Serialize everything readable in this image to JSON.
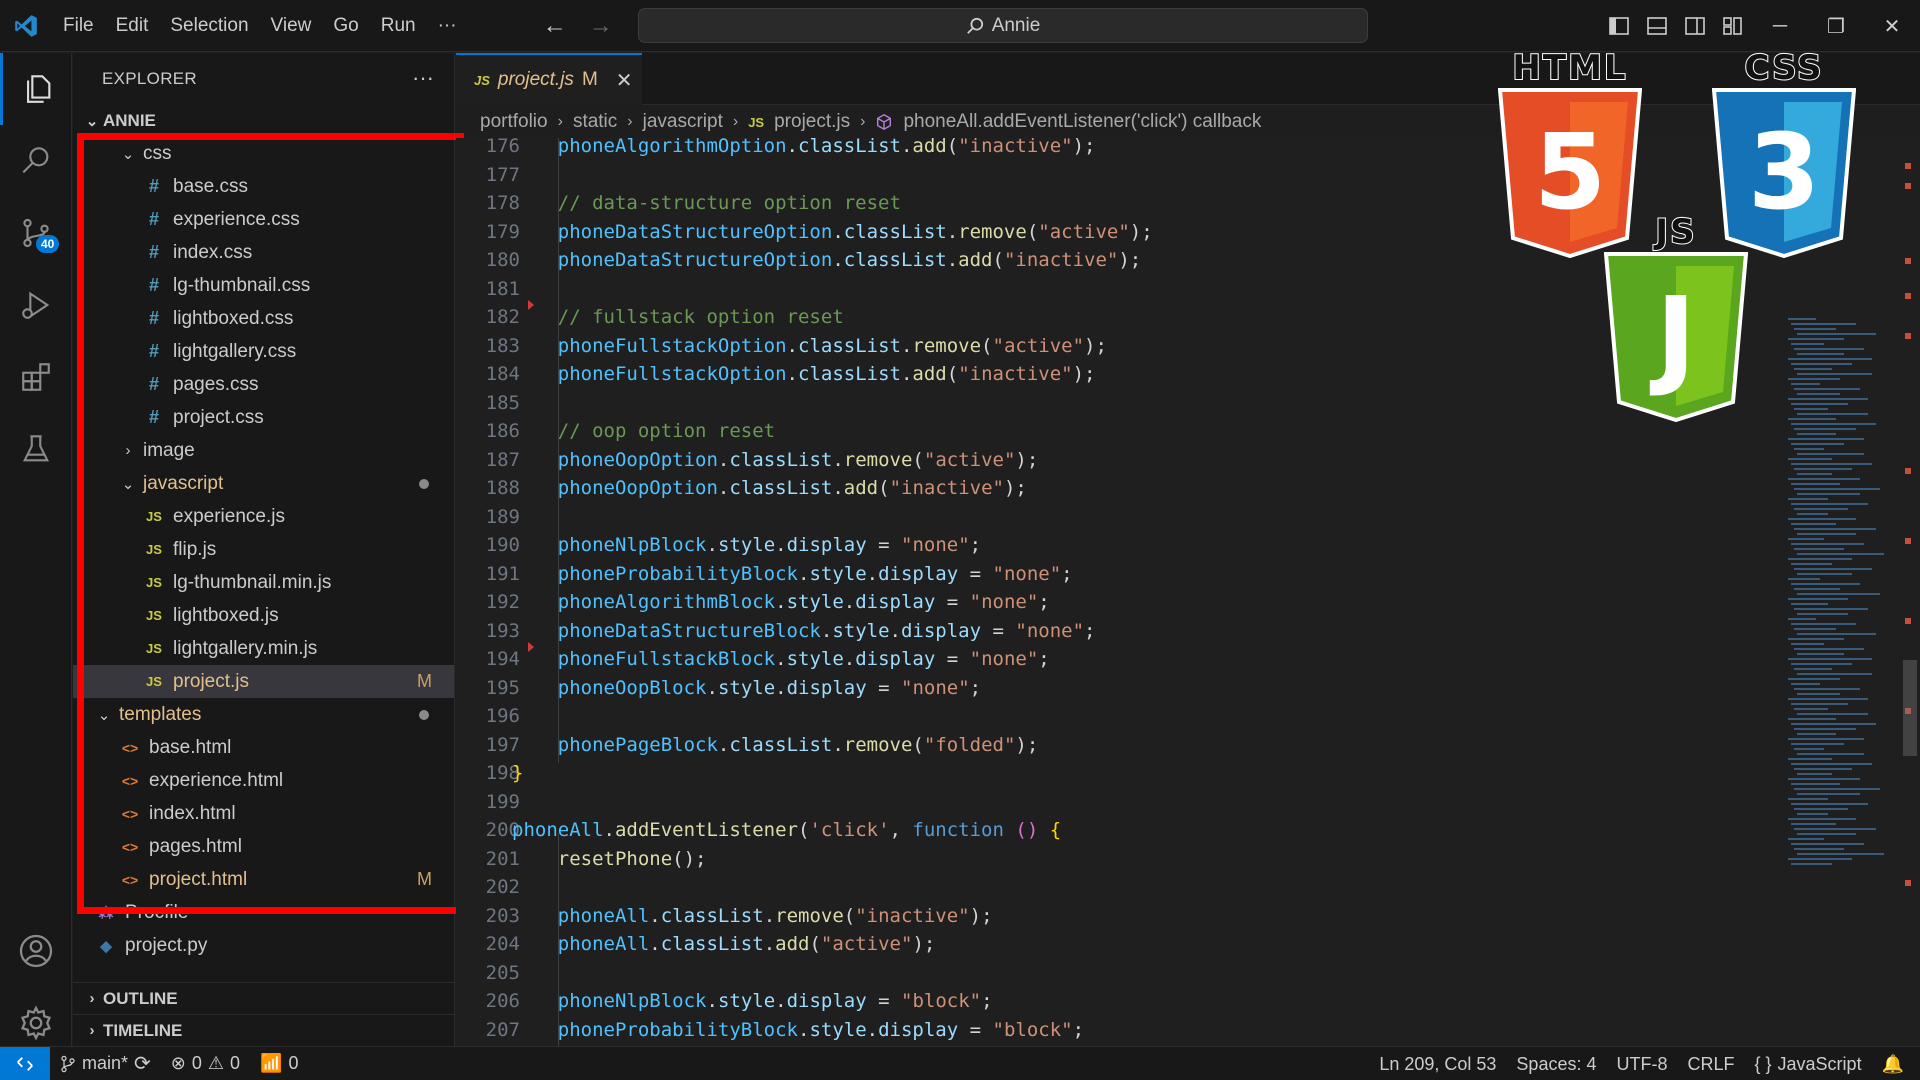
{
  "menu": [
    "File",
    "Edit",
    "Selection",
    "View",
    "Go",
    "Run",
    "···"
  ],
  "search": {
    "text": "Annie"
  },
  "activity": {
    "badge": "40"
  },
  "explorer": {
    "title": "EXPLORER",
    "more": "···",
    "root": "ANNIE",
    "tree": [
      {
        "label": "css",
        "type": "folder",
        "open": true,
        "indent": 1
      },
      {
        "label": "base.css",
        "type": "css",
        "indent": 2
      },
      {
        "label": "experience.css",
        "type": "css",
        "indent": 2
      },
      {
        "label": "index.css",
        "type": "css",
        "indent": 2
      },
      {
        "label": "lg-thumbnail.css",
        "type": "css",
        "indent": 2
      },
      {
        "label": "lightboxed.css",
        "type": "css",
        "indent": 2
      },
      {
        "label": "lightgallery.css",
        "type": "css",
        "indent": 2
      },
      {
        "label": "pages.css",
        "type": "css",
        "indent": 2
      },
      {
        "label": "project.css",
        "type": "css",
        "indent": 2
      },
      {
        "label": "image",
        "type": "folder",
        "open": false,
        "indent": 1
      },
      {
        "label": "javascript",
        "type": "folder",
        "open": true,
        "indent": 1,
        "modified_dot": true
      },
      {
        "label": "experience.js",
        "type": "js",
        "indent": 2
      },
      {
        "label": "flip.js",
        "type": "js",
        "indent": 2
      },
      {
        "label": "lg-thumbnail.min.js",
        "type": "js",
        "indent": 2
      },
      {
        "label": "lightboxed.js",
        "type": "js",
        "indent": 2
      },
      {
        "label": "lightgallery.min.js",
        "type": "js",
        "indent": 2
      },
      {
        "label": "project.js",
        "type": "js",
        "indent": 2,
        "status": "M",
        "selected": true
      },
      {
        "label": "templates",
        "type": "folder",
        "open": true,
        "indent": 0,
        "modified_dot": true
      },
      {
        "label": "base.html",
        "type": "html",
        "indent": 1
      },
      {
        "label": "experience.html",
        "type": "html",
        "indent": 1
      },
      {
        "label": "index.html",
        "type": "html",
        "indent": 1
      },
      {
        "label": "pages.html",
        "type": "html",
        "indent": 1
      },
      {
        "label": "project.html",
        "type": "html",
        "indent": 1,
        "status": "M"
      },
      {
        "label": "Procfile",
        "type": "proc",
        "indent": 0
      },
      {
        "label": "project.py",
        "type": "py",
        "indent": 0
      }
    ],
    "outline": "OUTLINE",
    "timeline": "TIMELINE"
  },
  "tab": {
    "icon": "JS",
    "name": "project.js",
    "status": "M"
  },
  "breadcrumb": [
    "portfolio",
    "static",
    "javascript",
    "project.js",
    "phoneAll.addEventListener('click') callback"
  ],
  "code": [
    {
      "n": "176",
      "t": [
        [
          "    ",
          ""
        ],
        [
          "phoneAlgorithmOption",
          "var"
        ],
        [
          ".",
          ""
        ],
        [
          "classList",
          "prop"
        ],
        [
          ".",
          ""
        ],
        [
          "add",
          "fn"
        ],
        [
          "(",
          ""
        ],
        [
          "\"inactive\"",
          "str"
        ],
        [
          ");",
          ""
        ]
      ]
    },
    {
      "n": "177",
      "t": []
    },
    {
      "n": "178",
      "t": [
        [
          "    ",
          ""
        ],
        [
          "// data-structure option reset",
          "com"
        ]
      ]
    },
    {
      "n": "179",
      "t": [
        [
          "    ",
          ""
        ],
        [
          "phoneDataStructureOption",
          "var"
        ],
        [
          ".",
          ""
        ],
        [
          "classList",
          "prop"
        ],
        [
          ".",
          ""
        ],
        [
          "remove",
          "fn"
        ],
        [
          "(",
          ""
        ],
        [
          "\"active\"",
          "str"
        ],
        [
          ");",
          ""
        ]
      ]
    },
    {
      "n": "180",
      "t": [
        [
          "    ",
          ""
        ],
        [
          "phoneDataStructureOption",
          "var"
        ],
        [
          ".",
          ""
        ],
        [
          "classList",
          "prop"
        ],
        [
          ".",
          ""
        ],
        [
          "add",
          "fn"
        ],
        [
          "(",
          ""
        ],
        [
          "\"inactive\"",
          "str"
        ],
        [
          ");",
          ""
        ]
      ]
    },
    {
      "n": "181",
      "t": []
    },
    {
      "n": "182",
      "t": [
        [
          "    ",
          ""
        ],
        [
          "// fullstack option reset",
          "com"
        ]
      ]
    },
    {
      "n": "183",
      "t": [
        [
          "    ",
          ""
        ],
        [
          "phoneFullstackOption",
          "var"
        ],
        [
          ".",
          ""
        ],
        [
          "classList",
          "prop"
        ],
        [
          ".",
          ""
        ],
        [
          "remove",
          "fn"
        ],
        [
          "(",
          ""
        ],
        [
          "\"active\"",
          "str"
        ],
        [
          ");",
          ""
        ]
      ]
    },
    {
      "n": "184",
      "t": [
        [
          "    ",
          ""
        ],
        [
          "phoneFullstackOption",
          "var"
        ],
        [
          ".",
          ""
        ],
        [
          "classList",
          "prop"
        ],
        [
          ".",
          ""
        ],
        [
          "add",
          "fn"
        ],
        [
          "(",
          ""
        ],
        [
          "\"inactive\"",
          "str"
        ],
        [
          ");",
          ""
        ]
      ]
    },
    {
      "n": "185",
      "t": []
    },
    {
      "n": "186",
      "t": [
        [
          "    ",
          ""
        ],
        [
          "// oop option reset",
          "com"
        ]
      ]
    },
    {
      "n": "187",
      "t": [
        [
          "    ",
          ""
        ],
        [
          "phoneOopOption",
          "var"
        ],
        [
          ".",
          ""
        ],
        [
          "classList",
          "prop"
        ],
        [
          ".",
          ""
        ],
        [
          "remove",
          "fn"
        ],
        [
          "(",
          ""
        ],
        [
          "\"active\"",
          "str"
        ],
        [
          ");",
          ""
        ]
      ]
    },
    {
      "n": "188",
      "t": [
        [
          "    ",
          ""
        ],
        [
          "phoneOopOption",
          "var"
        ],
        [
          ".",
          ""
        ],
        [
          "classList",
          "prop"
        ],
        [
          ".",
          ""
        ],
        [
          "add",
          "fn"
        ],
        [
          "(",
          ""
        ],
        [
          "\"inactive\"",
          "str"
        ],
        [
          ");",
          ""
        ]
      ]
    },
    {
      "n": "189",
      "t": []
    },
    {
      "n": "190",
      "t": [
        [
          "    ",
          ""
        ],
        [
          "phoneNlpBlock",
          "var"
        ],
        [
          ".",
          ""
        ],
        [
          "style",
          "prop"
        ],
        [
          ".",
          ""
        ],
        [
          "display",
          "prop"
        ],
        [
          " = ",
          ""
        ],
        [
          "\"none\"",
          "str"
        ],
        [
          ";",
          ""
        ]
      ]
    },
    {
      "n": "191",
      "t": [
        [
          "    ",
          ""
        ],
        [
          "phoneProbabilityBlock",
          "var"
        ],
        [
          ".",
          ""
        ],
        [
          "style",
          "prop"
        ],
        [
          ".",
          ""
        ],
        [
          "display",
          "prop"
        ],
        [
          " = ",
          ""
        ],
        [
          "\"none\"",
          "str"
        ],
        [
          ";",
          ""
        ]
      ]
    },
    {
      "n": "192",
      "t": [
        [
          "    ",
          ""
        ],
        [
          "phoneAlgorithmBlock",
          "var"
        ],
        [
          ".",
          ""
        ],
        [
          "style",
          "prop"
        ],
        [
          ".",
          ""
        ],
        [
          "display",
          "prop"
        ],
        [
          " = ",
          ""
        ],
        [
          "\"none\"",
          "str"
        ],
        [
          ";",
          ""
        ]
      ]
    },
    {
      "n": "193",
      "t": [
        [
          "    ",
          ""
        ],
        [
          "phoneDataStructureBlock",
          "var"
        ],
        [
          ".",
          ""
        ],
        [
          "style",
          "prop"
        ],
        [
          ".",
          ""
        ],
        [
          "display",
          "prop"
        ],
        [
          " = ",
          ""
        ],
        [
          "\"none\"",
          "str"
        ],
        [
          ";",
          ""
        ]
      ]
    },
    {
      "n": "194",
      "t": [
        [
          "    ",
          ""
        ],
        [
          "phoneFullstackBlock",
          "var"
        ],
        [
          ".",
          ""
        ],
        [
          "style",
          "prop"
        ],
        [
          ".",
          ""
        ],
        [
          "display",
          "prop"
        ],
        [
          " = ",
          ""
        ],
        [
          "\"none\"",
          "str"
        ],
        [
          ";",
          ""
        ]
      ]
    },
    {
      "n": "195",
      "t": [
        [
          "    ",
          ""
        ],
        [
          "phoneOopBlock",
          "var"
        ],
        [
          ".",
          ""
        ],
        [
          "style",
          "prop"
        ],
        [
          ".",
          ""
        ],
        [
          "display",
          "prop"
        ],
        [
          " = ",
          ""
        ],
        [
          "\"none\"",
          "str"
        ],
        [
          ";",
          ""
        ]
      ]
    },
    {
      "n": "196",
      "t": []
    },
    {
      "n": "197",
      "t": [
        [
          "    ",
          ""
        ],
        [
          "phonePageBlock",
          "var"
        ],
        [
          ".",
          ""
        ],
        [
          "classList",
          "prop"
        ],
        [
          ".",
          ""
        ],
        [
          "remove",
          "fn"
        ],
        [
          "(",
          ""
        ],
        [
          "\"folded\"",
          "str"
        ],
        [
          ");",
          ""
        ]
      ]
    },
    {
      "n": "198",
      "t": [
        [
          "}",
          "br"
        ]
      ]
    },
    {
      "n": "199",
      "t": []
    },
    {
      "n": "200",
      "t": [
        [
          "phoneAll",
          "var"
        ],
        [
          ".",
          ""
        ],
        [
          "addEventListener",
          "fn"
        ],
        [
          "(",
          ""
        ],
        [
          "'click'",
          "str"
        ],
        [
          ", ",
          ""
        ],
        [
          "function",
          "kw"
        ],
        [
          " ",
          ""
        ],
        [
          "()",
          "p"
        ],
        [
          " ",
          ""
        ],
        [
          "{",
          "br"
        ]
      ]
    },
    {
      "n": "201",
      "t": [
        [
          "    ",
          ""
        ],
        [
          "resetPhone",
          "fn"
        ],
        [
          "();",
          ""
        ]
      ]
    },
    {
      "n": "202",
      "t": []
    },
    {
      "n": "203",
      "t": [
        [
          "    ",
          ""
        ],
        [
          "phoneAll",
          "var"
        ],
        [
          ".",
          ""
        ],
        [
          "classList",
          "prop"
        ],
        [
          ".",
          ""
        ],
        [
          "remove",
          "fn"
        ],
        [
          "(",
          ""
        ],
        [
          "\"inactive\"",
          "str"
        ],
        [
          ");",
          ""
        ]
      ]
    },
    {
      "n": "204",
      "t": [
        [
          "    ",
          ""
        ],
        [
          "phoneAll",
          "var"
        ],
        [
          ".",
          ""
        ],
        [
          "classList",
          "prop"
        ],
        [
          ".",
          ""
        ],
        [
          "add",
          "fn"
        ],
        [
          "(",
          ""
        ],
        [
          "\"active\"",
          "str"
        ],
        [
          ");",
          ""
        ]
      ]
    },
    {
      "n": "205",
      "t": []
    },
    {
      "n": "206",
      "t": [
        [
          "    ",
          ""
        ],
        [
          "phoneNlpBlock",
          "var"
        ],
        [
          ".",
          ""
        ],
        [
          "style",
          "prop"
        ],
        [
          ".",
          ""
        ],
        [
          "display",
          "prop"
        ],
        [
          " = ",
          ""
        ],
        [
          "\"block\"",
          "str"
        ],
        [
          ";",
          ""
        ]
      ]
    },
    {
      "n": "207",
      "t": [
        [
          "    ",
          ""
        ],
        [
          "phoneProbabilityBlock",
          "var"
        ],
        [
          ".",
          ""
        ],
        [
          "style",
          "prop"
        ],
        [
          ".",
          ""
        ],
        [
          "display",
          "prop"
        ],
        [
          " = ",
          ""
        ],
        [
          "\"block\"",
          "str"
        ],
        [
          ";",
          ""
        ]
      ]
    }
  ],
  "logos": {
    "html": "HTML",
    "css": "CSS",
    "js": "JS",
    "html_digit": "5",
    "css_digit": "3",
    "js_letter": "J"
  },
  "statusbar": {
    "branch": "main*",
    "errors": "0",
    "warnings": "0",
    "ports": "0",
    "position": "Ln 209, Col 53",
    "spaces": "Spaces: 4",
    "encoding": "UTF-8",
    "eol": "CRLF",
    "language_icon": "{ }",
    "language": "JavaScript"
  }
}
